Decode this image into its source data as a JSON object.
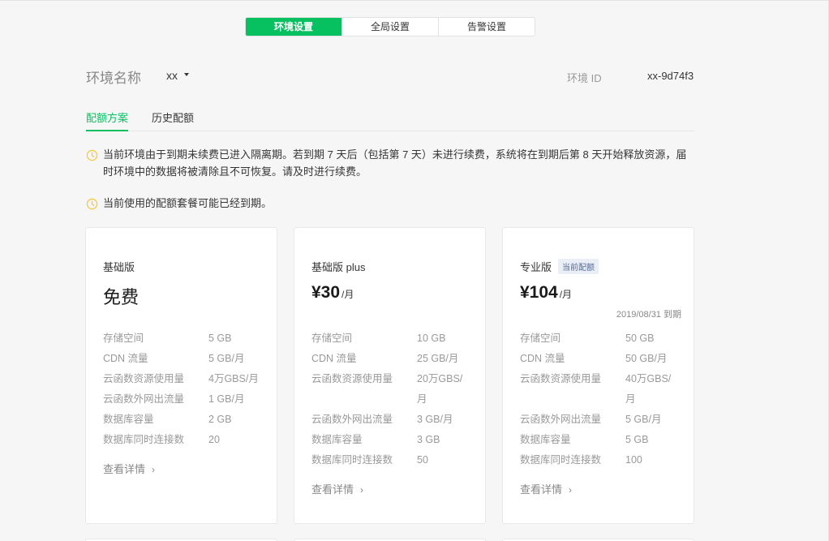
{
  "top_tabs": [
    "环境设置",
    "全局设置",
    "告警设置"
  ],
  "env": {
    "label": "环境名称",
    "selected": "xx",
    "id_label": "环境 ID",
    "id_value": "xx-9d74f3"
  },
  "sub_tabs": [
    "配额方案",
    "历史配额"
  ],
  "notices": [
    "当前环境由于到期未续费已进入隔离期。若到期 7 天后（包括第 7 天）未进行续费，系统将在到期后第 8 天开始释放资源，届时环境中的数据将被清除且不可恢复。请及时进行续费。",
    "当前使用的配额套餐可能已经到期。"
  ],
  "plans": [
    {
      "name": "基础版",
      "price_text": "免费",
      "specs": [
        {
          "k": "存储空间",
          "v": "5 GB"
        },
        {
          "k": "CDN 流量",
          "v": "5 GB/月"
        },
        {
          "k": "云函数资源使用量",
          "v": "4万GBS/月"
        },
        {
          "k": "云函数外网出流量",
          "v": "1 GB/月"
        },
        {
          "k": "数据库容量",
          "v": "2 GB"
        },
        {
          "k": "数据库同时连接数",
          "v": "20"
        }
      ],
      "more": "查看详情"
    },
    {
      "name": "基础版 plus",
      "price": "¥30",
      "unit": "/月",
      "specs": [
        {
          "k": "存储空间",
          "v": "10 GB"
        },
        {
          "k": "CDN 流量",
          "v": "25 GB/月"
        },
        {
          "k": "云函数资源使用量",
          "v": "20万GBS/月"
        },
        {
          "k": "云函数外网出流量",
          "v": "3 GB/月"
        },
        {
          "k": "数据库容量",
          "v": "3 GB"
        },
        {
          "k": "数据库同时连接数",
          "v": "50"
        }
      ],
      "more": "查看详情"
    },
    {
      "name": "专业版",
      "badge": "当前配额",
      "price": "¥104",
      "unit": "/月",
      "expiry": "2019/08/31 到期",
      "specs": [
        {
          "k": "存储空间",
          "v": "50 GB"
        },
        {
          "k": "CDN 流量",
          "v": "50 GB/月"
        },
        {
          "k": "云函数资源使用量",
          "v": "40万GBS/月"
        },
        {
          "k": "云函数外网出流量",
          "v": "5 GB/月"
        },
        {
          "k": "数据库容量",
          "v": "5 GB"
        },
        {
          "k": "数据库同时连接数",
          "v": "100"
        }
      ],
      "more": "查看详情"
    }
  ],
  "colors": {
    "accent": "#07c160",
    "warning": "#f5c84a",
    "badge_text": "#576b95"
  }
}
